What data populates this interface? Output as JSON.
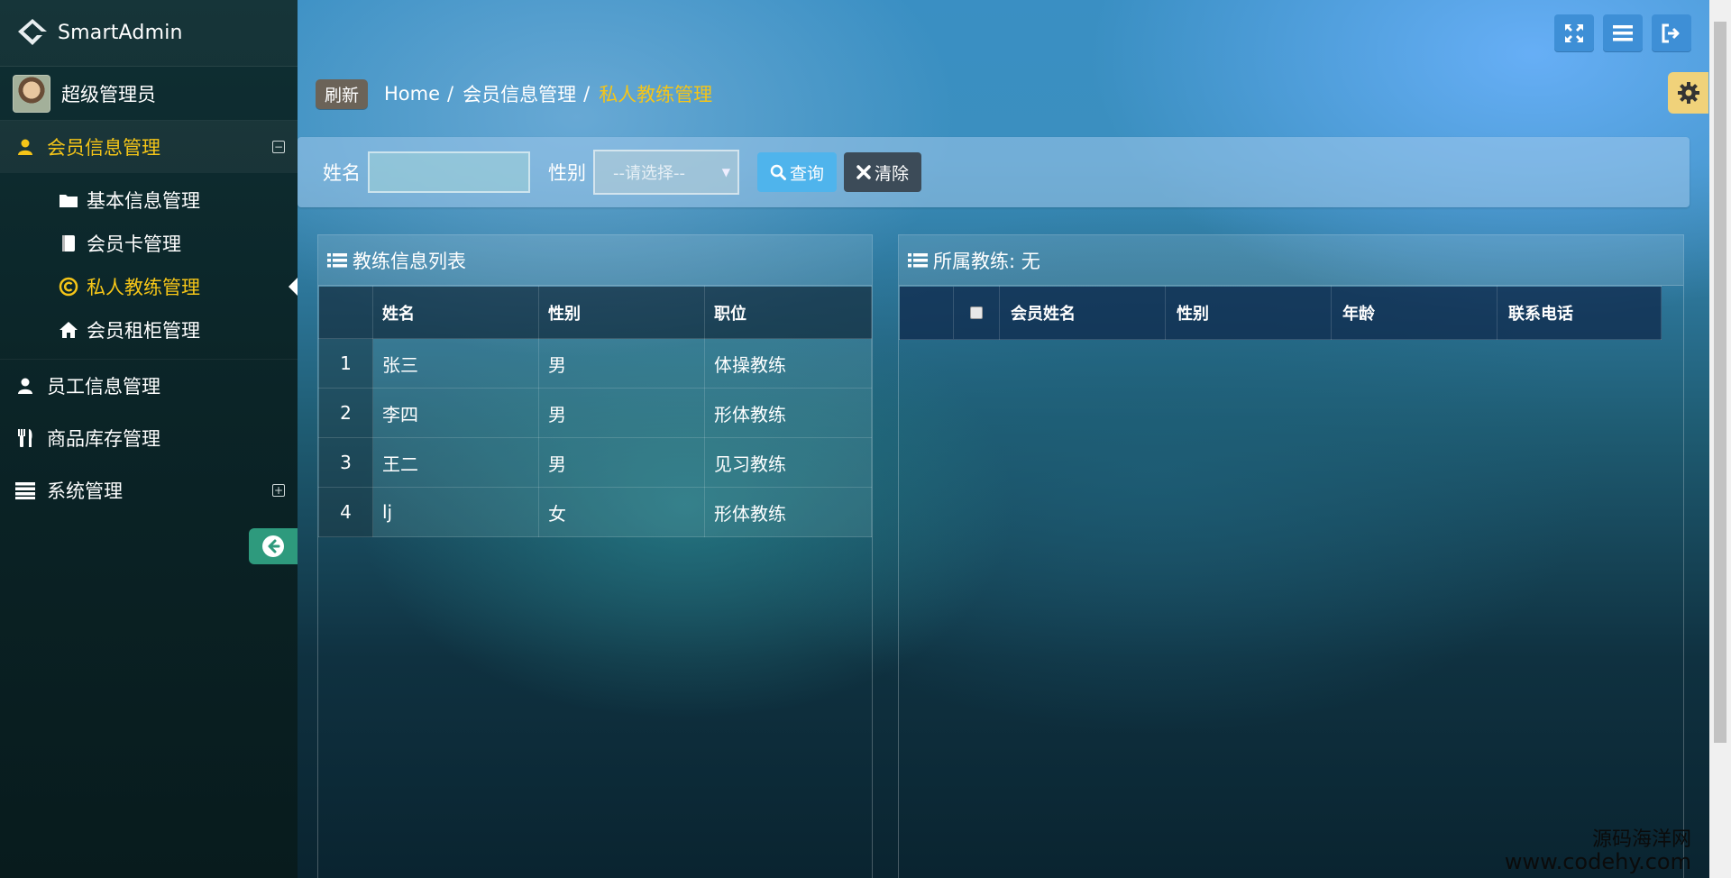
{
  "brand": {
    "name": "SmartAdmin"
  },
  "user": {
    "name": "超级管理员"
  },
  "sidebar": {
    "groups": [
      {
        "label": "会员信息管理",
        "icon": "user-icon",
        "expanded": true
      },
      {
        "label": "员工信息管理",
        "icon": "user-icon"
      },
      {
        "label": "商品库存管理",
        "icon": "cutlery-icon"
      },
      {
        "label": "系统管理",
        "icon": "list-icon",
        "expanded": false
      }
    ],
    "subitems": [
      {
        "label": "基本信息管理",
        "icon": "folder-icon"
      },
      {
        "label": "会员卡管理",
        "icon": "book-icon"
      },
      {
        "label": "私人教练管理",
        "icon": "copyright-icon",
        "active": true
      },
      {
        "label": "会员租柜管理",
        "icon": "home-icon"
      }
    ]
  },
  "breadcrumb": {
    "refresh_label": "刷新",
    "items": [
      "Home",
      "会员信息管理",
      "私人教练管理"
    ]
  },
  "search": {
    "name_label": "姓名",
    "name_value": "",
    "sex_label": "性别",
    "sex_selected": "--请选择--",
    "query_label": "查询",
    "clear_label": "清除"
  },
  "left_panel": {
    "title": "教练信息列表",
    "columns": [
      "",
      "姓名",
      "性别",
      "职位"
    ],
    "rows": [
      {
        "idx": "1",
        "name": "张三",
        "sex": "男",
        "position": "体操教练"
      },
      {
        "idx": "2",
        "name": "李四",
        "sex": "男",
        "position": "形体教练"
      },
      {
        "idx": "3",
        "name": "王二",
        "sex": "男",
        "position": "见习教练"
      },
      {
        "idx": "4",
        "name": "lj",
        "sex": "女",
        "position": "形体教练"
      }
    ]
  },
  "right_panel": {
    "title": "所属教练: 无",
    "columns": [
      "会员姓名",
      "性别",
      "年龄",
      "联系电话"
    ]
  },
  "watermark": {
    "line1": "源码海洋网",
    "line2": "www.codehy.com"
  },
  "colors": {
    "accent": "#f5c518",
    "query_button": "#4fb4ec",
    "clear_button": "#3c4b58",
    "sidebar": "#0b2427"
  }
}
